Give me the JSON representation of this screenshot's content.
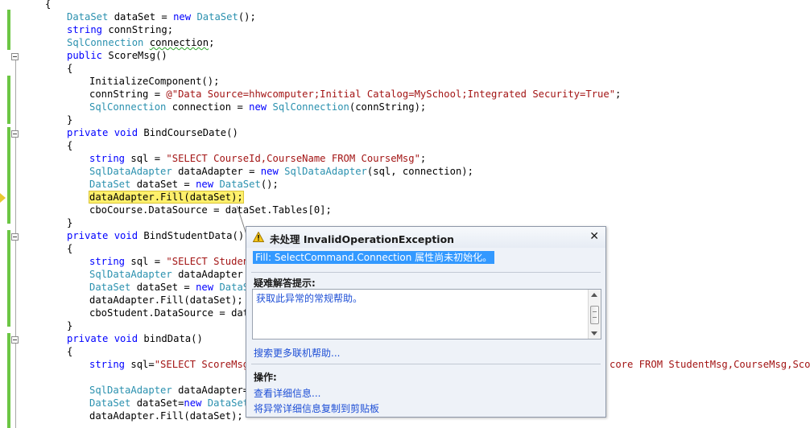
{
  "code": {
    "open_brace": "{",
    "l1": {
      "t1": "DataSet",
      "t2": " dataSet = ",
      "t3": "new",
      "t4": " ",
      "t5": "DataSet",
      "t6": "();"
    },
    "l2": {
      "t1": "string",
      "t2": " connString;"
    },
    "l3": {
      "t1": "SqlConnection",
      "t2": " ",
      "t3": "connection",
      "t4": ";"
    },
    "l4": {
      "t1": "public",
      "t2": " ScoreMsg()"
    },
    "l5": "{",
    "l6": "InitializeComponent();",
    "l7": {
      "t1": "connString = ",
      "t2": "@\"Data Source=hhwcomputer;Initial Catalog=MySchool;Integrated Security=True\"",
      "t3": ";"
    },
    "l8": {
      "t1": "SqlConnection",
      "t2": " connection = ",
      "t3": "new",
      "t4": " ",
      "t5": "SqlConnection",
      "t6": "(connString);"
    },
    "l9": "}",
    "l10": {
      "t1": "private",
      "t2": " ",
      "t3": "void",
      "t4": " BindCourseDate()"
    },
    "l11": "{",
    "l12": {
      "t1": "string",
      "t2": " sql = ",
      "t3": "\"SELECT CourseId,CourseName FROM CourseMsg\"",
      "t4": ";"
    },
    "l13": {
      "t1": "SqlDataAdapter",
      "t2": " dataAdapter = ",
      "t3": "new",
      "t4": " ",
      "t5": "SqlDataAdapter",
      "t6": "(sql, connection);"
    },
    "l14": {
      "t1": "DataSet",
      "t2": " dataSet = ",
      "t3": "new",
      "t4": " ",
      "t5": "DataSet",
      "t6": "();"
    },
    "l15": "dataAdapter.Fill(dataSet);",
    "l16": "cboCourse.DataSource = dataSet.Tables[0];",
    "l17": "}",
    "l18": {
      "t1": "private",
      "t2": " ",
      "t3": "void",
      "t4": " BindStudentData()"
    },
    "l19": "{",
    "l20": {
      "t1": "string",
      "t2": " sql = ",
      "t3": "\"SELECT Student"
    },
    "l21": {
      "t1": "SqlDataAdapter",
      "t2": " dataAdapter = "
    },
    "l22": {
      "t1": "DataSet",
      "t2": " dataSet = ",
      "t3": "new",
      "t4": " ",
      "t5": "DataS"
    },
    "l23": "dataAdapter.Fill(dataSet);",
    "l24": "cboStudent.DataSource = data",
    "l25": "}",
    "l26": {
      "t1": "private",
      "t2": " ",
      "t3": "void",
      "t4": " bindData()"
    },
    "l27": "{",
    "l28": {
      "t1": "string",
      "t2": " sql=",
      "t3": "\"SELECT ScoreMsg."
    },
    "l28b": {
      "t1": "core FROM StudentMsg,CourseMsg,Score"
    },
    "l29": {
      "t1": "SqlDataAdapter",
      "t2": " dataAdapter=n"
    },
    "l30": {
      "t1": "DataSet",
      "t2": " dataSet=",
      "t3": "new",
      "t4": " ",
      "t5": "DataSet"
    },
    "l31": "dataAdapter.Fill(dataSet);"
  },
  "exception_assistant": {
    "title": "未处理 InvalidOperationException",
    "close_icon": "close-icon",
    "warning_icon": "warning-icon",
    "message": "Fill: SelectCommand.Connection 属性尚未初始化。",
    "tips_header": "疑难解答提示:",
    "tips_link": "获取此异常的常规帮助。",
    "online_help_link": "搜索更多联机帮助...",
    "actions_header": "操作:",
    "actions": [
      "查看详细信息...",
      "将异常详细信息复制到剪贴板"
    ]
  },
  "colors": {
    "keyword": "#0000ff",
    "type": "#2b91af",
    "string": "#a31515",
    "highlight": "#fef06b",
    "change_bar": "#6cc644",
    "link": "#1e4fd6",
    "selection": "#3399ff"
  }
}
